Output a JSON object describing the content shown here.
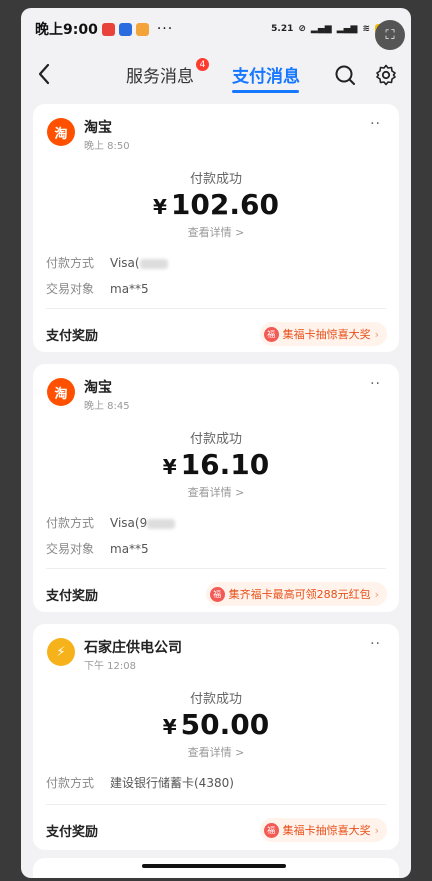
{
  "status_bar": {
    "time": "晚上9:00",
    "more": "···",
    "speed": "5.21\nKB/s"
  },
  "nav": {
    "tabs": [
      {
        "label": "服务消息",
        "badge": "4"
      },
      {
        "label": "支付消息"
      }
    ]
  },
  "common": {
    "pay_status": "付款成功",
    "view_detail": "查看详情 >",
    "reward_label": "支付奖励",
    "pay_method_label": "付款方式",
    "counterparty_label": "交易对象"
  },
  "messages": [
    {
      "merchant": "淘宝",
      "logo_char": "淘",
      "time": "晚上 8:50",
      "amount": "102.60",
      "pay_method": "Visa(",
      "counterparty": "ma**5",
      "reward": "集福卡抽惊喜大奖"
    },
    {
      "merchant": "淘宝",
      "logo_char": "淘",
      "time": "晚上 8:45",
      "amount": "16.10",
      "pay_method": "Visa(9",
      "counterparty": "ma**5",
      "reward": "集齐福卡最高可领288元红包"
    },
    {
      "merchant": "石家庄供电公司",
      "logo_char": "⚡",
      "time": "下午 12:08",
      "amount": "50.00",
      "pay_method": "建设银行储蓄卡(4380)",
      "reward": "集福卡抽惊喜大奖"
    }
  ],
  "currency": "¥",
  "colors": {
    "accent": "#1677ff",
    "taobao": "#ff5000",
    "power": "#f6b21b",
    "reward_text": "#e8501a"
  }
}
